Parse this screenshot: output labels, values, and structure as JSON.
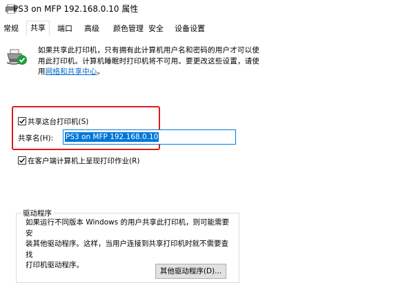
{
  "window": {
    "title": "PS3 on MFP 192.168.0.10 属性"
  },
  "tabs": [
    {
      "label": "常规",
      "active": false
    },
    {
      "label": "共享",
      "active": true
    },
    {
      "label": "端口",
      "active": false
    },
    {
      "label": "高级",
      "active": false
    },
    {
      "label": "颜色管理",
      "active": false
    },
    {
      "label": "安全",
      "active": false
    },
    {
      "label": "设备设置",
      "active": false
    }
  ],
  "info": {
    "line1": "如果共享此打印机，只有拥有此计算机用户名和密码的用户才可以使",
    "line2": "用此打印机。计算机睡眠时打印机将不可用。要更改这些设置，请使",
    "line3_prefix": "用",
    "link": "网络和共享中心",
    "line3_suffix": "。"
  },
  "share": {
    "checkbox_label": "共享这台打印机(S)",
    "checked": true,
    "name_label": "共享名(H):",
    "name_value": "PS3 on MFP 192.168.0.10"
  },
  "render_jobs": {
    "checkbox_label": "在客户端计算机上呈现打印作业(R)",
    "checked": true
  },
  "drivers": {
    "group_label": "驱动程序",
    "line1": "如果运行不同版本 Windows 的用户共享此打印机，则可能需要安",
    "line2": "装其他驱动程序。这样，当用户连接到共享打印机时就不需要查找",
    "line3": "打印机驱动程序。",
    "button_label": "其他驱动程序(D)..."
  },
  "colors": {
    "accent": "#0078d7",
    "highlight": "#e0171b",
    "link": "#0066cc"
  }
}
